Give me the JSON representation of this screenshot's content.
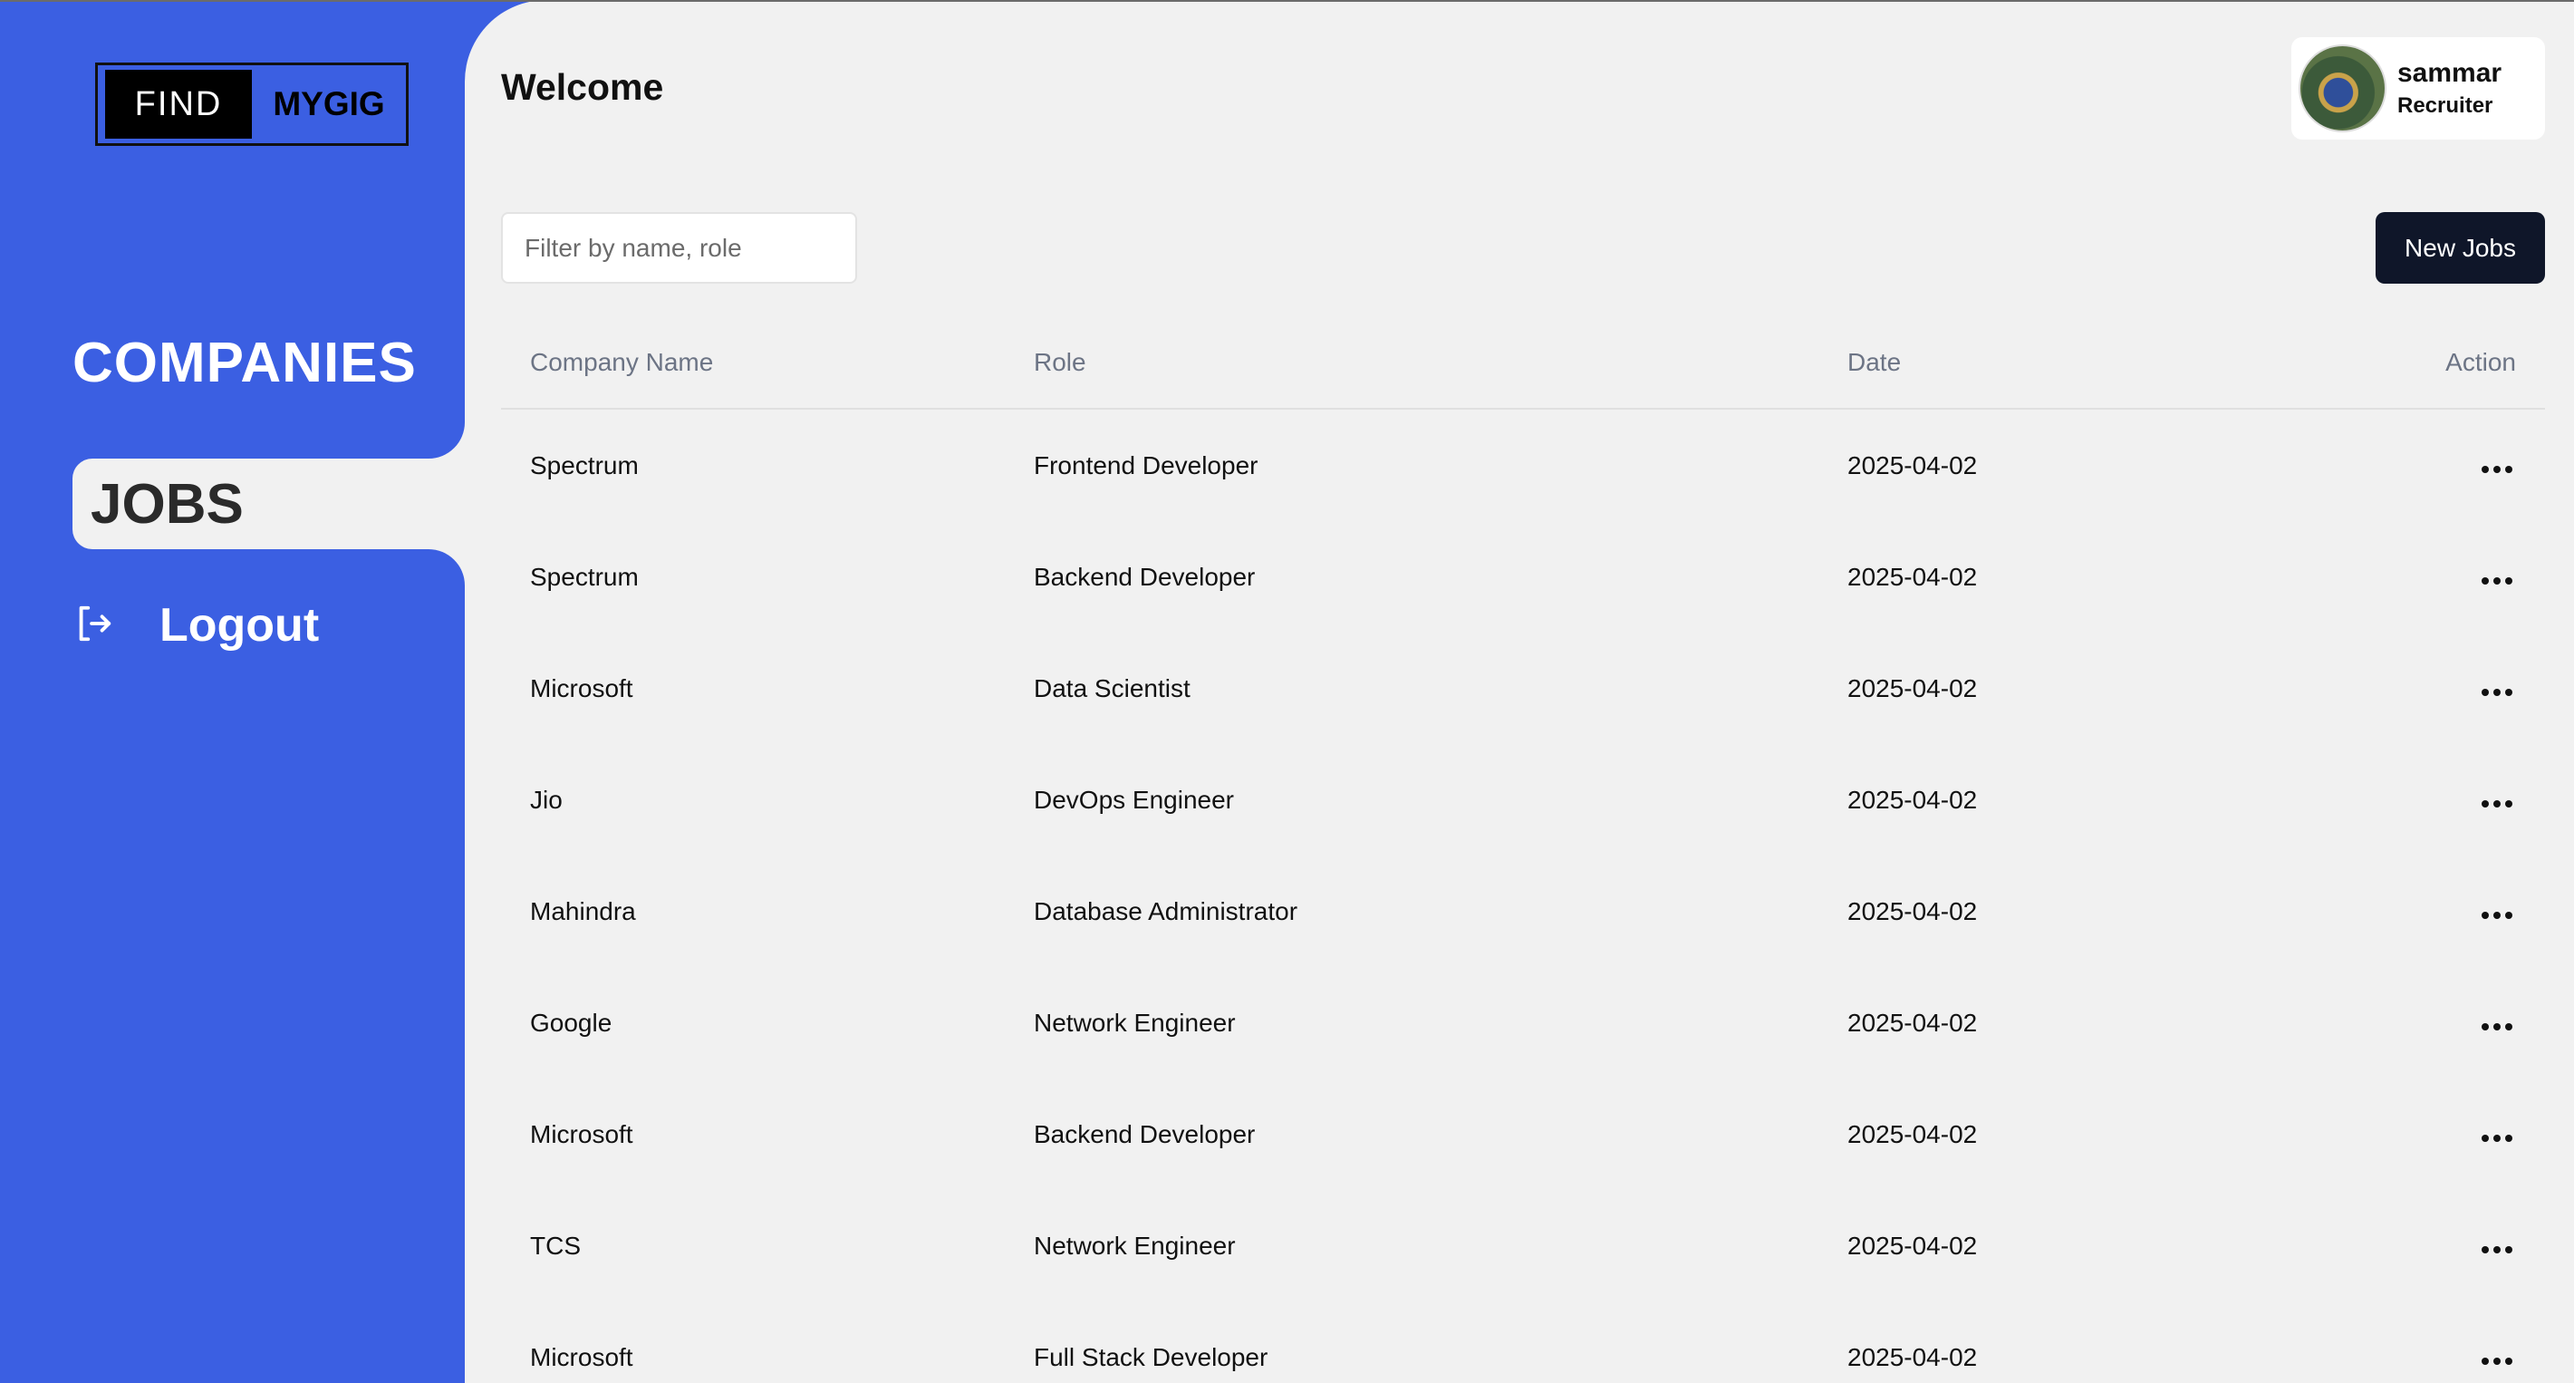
{
  "brand": {
    "left": "FIND",
    "right": "MYGIG"
  },
  "sidebar": {
    "items": [
      {
        "label": "COMPANIES"
      },
      {
        "label": "JOBS",
        "active": true
      },
      {
        "label": "Logout",
        "icon": "logout-icon"
      }
    ]
  },
  "header": {
    "title": "Welcome"
  },
  "profile": {
    "name": "sammar",
    "role": "Recruiter"
  },
  "filter": {
    "placeholder": "Filter by name, role",
    "value": ""
  },
  "toolbar": {
    "new_jobs_label": "New Jobs"
  },
  "table": {
    "headers": [
      "Company Name",
      "Role",
      "Date",
      "Action"
    ],
    "rows": [
      {
        "company": "Spectrum",
        "role": "Frontend Developer",
        "date": "2025-04-02"
      },
      {
        "company": "Spectrum",
        "role": "Backend Developer",
        "date": "2025-04-02"
      },
      {
        "company": "Microsoft",
        "role": "Data Scientist",
        "date": "2025-04-02"
      },
      {
        "company": "Jio",
        "role": "DevOps Engineer",
        "date": "2025-04-02"
      },
      {
        "company": "Mahindra",
        "role": "Database Administrator",
        "date": "2025-04-02"
      },
      {
        "company": "Google",
        "role": "Network Engineer",
        "date": "2025-04-02"
      },
      {
        "company": "Microsoft",
        "role": "Backend Developer",
        "date": "2025-04-02"
      },
      {
        "company": "TCS",
        "role": "Network Engineer",
        "date": "2025-04-02"
      },
      {
        "company": "Microsoft",
        "role": "Full Stack Developer",
        "date": "2025-04-02"
      }
    ]
  },
  "colors": {
    "sidebar": "#3b5fe2",
    "panel": "#f1f1f1",
    "primary_button": "#0f1629"
  }
}
